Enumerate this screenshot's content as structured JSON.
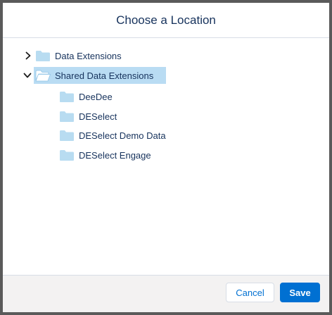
{
  "modal": {
    "title": "Choose a Location"
  },
  "tree": {
    "roots": [
      {
        "label": "Data Extensions",
        "expanded": false,
        "icon": "folder-closed-icon"
      },
      {
        "label": "Shared Data Extensions",
        "expanded": true,
        "selected": true,
        "icon": "folder-open-icon"
      }
    ],
    "children": [
      {
        "label": "DeeDee",
        "icon": "folder-closed-icon"
      },
      {
        "label": "DESelect",
        "icon": "folder-closed-icon"
      },
      {
        "label": "DESelect Demo Data",
        "icon": "folder-closed-icon"
      },
      {
        "label": "DESelect Engage",
        "icon": "folder-closed-icon"
      }
    ]
  },
  "footer": {
    "cancel_label": "Cancel",
    "save_label": "Save"
  },
  "colors": {
    "folder": "#b8dcf1",
    "selection": "#b9dcf3",
    "primary": "#0070d2",
    "text": "#16325c"
  }
}
